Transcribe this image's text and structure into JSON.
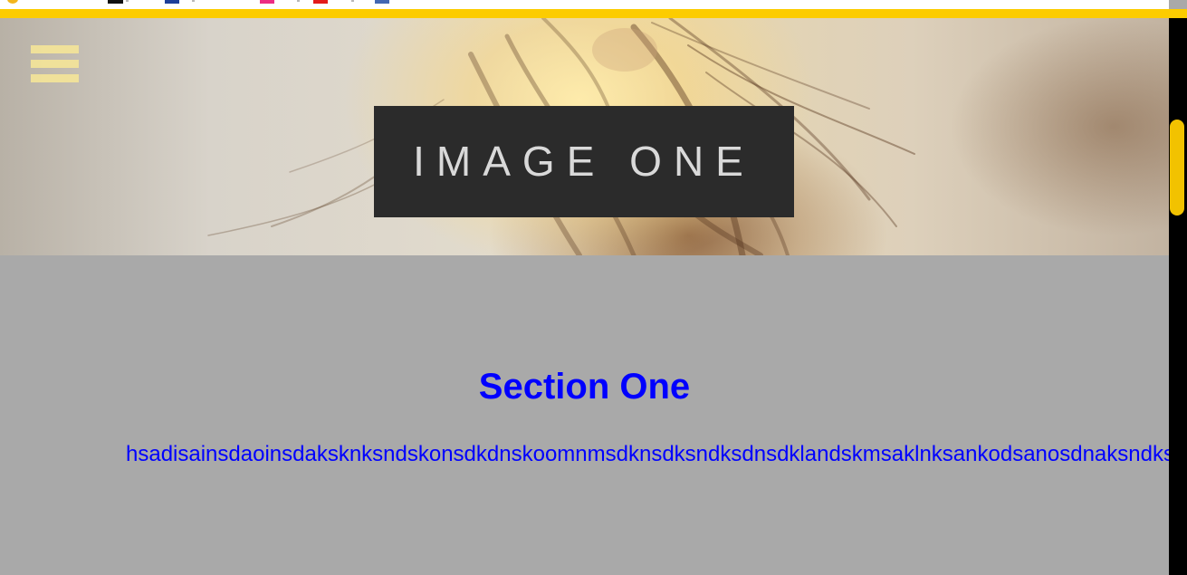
{
  "hero": {
    "label": "IMAGE ONE"
  },
  "section_one": {
    "title": "Section One",
    "body": "hsadisainsdaoinsdaksknksndskonsdkdnskoomnmsdknsdksndksdnsdklandskmsaklnksankodsanosdnaksndks"
  },
  "colors": {
    "accent": "#fccc00",
    "section_bg": "#a9a9a9",
    "section_text": "#0000ff",
    "label_bg": "#2b2b2b"
  },
  "icons": {
    "menu": "hamburger-menu-icon"
  }
}
